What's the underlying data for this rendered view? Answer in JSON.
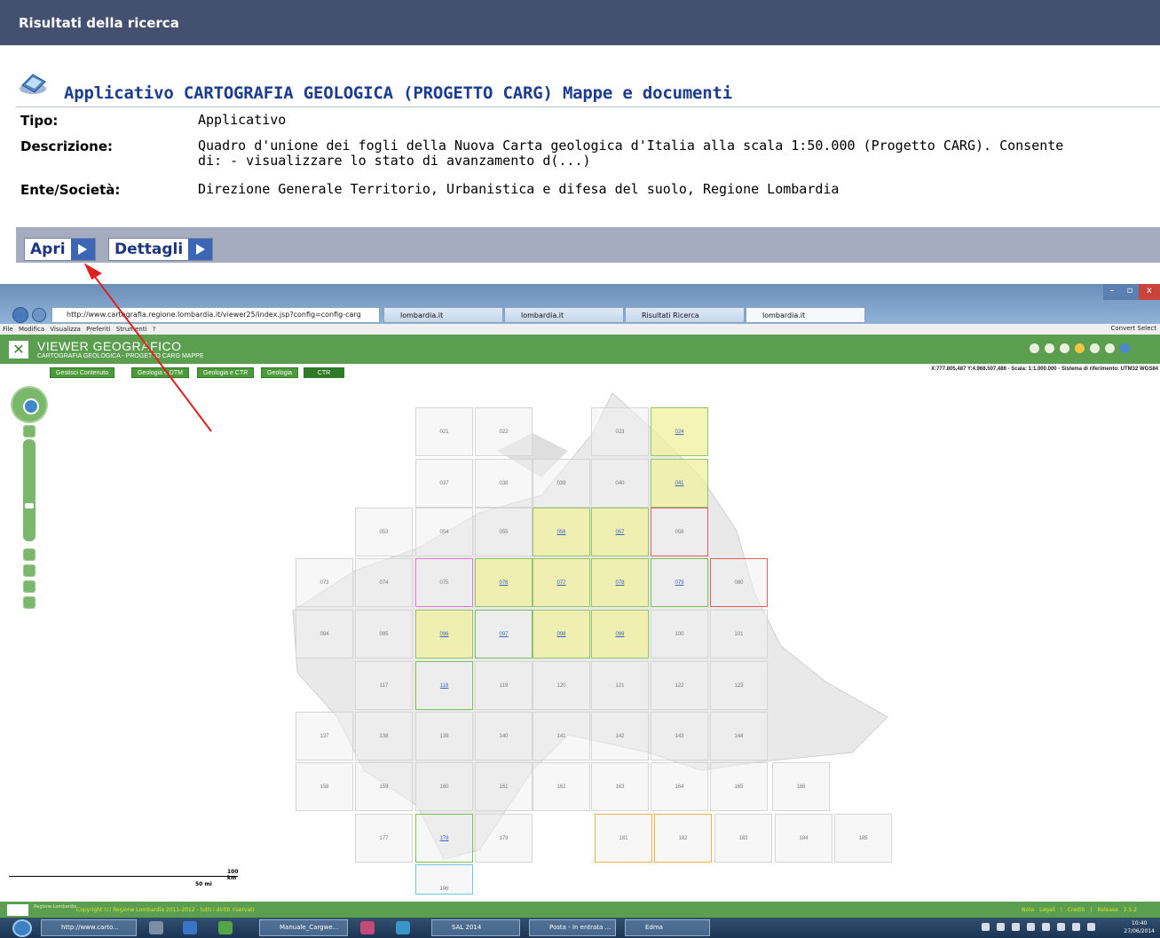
{
  "results": {
    "header": "Risultati della ricerca",
    "title": "Applicativo CARTOGRAFIA GEOLOGICA (PROGETTO CARG) Mappe e documenti",
    "tipo_label": "Tipo:",
    "tipo_value": "Applicativo",
    "descrizione_label": "Descrizione:",
    "descrizione_value": "Quadro d'unione dei fogli della Nuova Carta geologica d'Italia alla scala 1:50.000 (Progetto CARG). Consente\ndi: - visualizzare lo stato di avanzamento d(...)",
    "ente_label": "Ente/Società:",
    "ente_value": "Direzione Generale Territorio, Urbanistica e difesa del suolo, Regione Lombardia",
    "open_label": "Apri",
    "details_label": "Dettagli"
  },
  "browser": {
    "url": "http://www.cartografia.regione.lombardia.it/viewer25/index.jsp?config=config-carg",
    "tabs": [
      "lombardia.it",
      "lombardia.it",
      "Risultati Ricerca",
      "lombardia.it"
    ],
    "menu": "File  Modifica  Visualizza  Preferiti  Strumenti  ?",
    "menu_right": "Convert  Select"
  },
  "viewer": {
    "title": "VIEWER GEOGRAFICO",
    "subtitle": "CARTOGRAFIA GEOLOGICA - PROGETTO CARG MAPPE",
    "coords": "X:777.805,487 Y:4.968.507,486 - Scala: 1:1.000.000 - Sistema di riferimento: UTM32 WGS84",
    "tabs": [
      "Gestisci Contenuto",
      "Geologia e DTM",
      "Geologia e CTR",
      "Geologia",
      "CTR"
    ],
    "scale_km": "100 km",
    "scale_mi": "50 mi",
    "footer_region": "Regione Lombardia",
    "footer_copy": "Copyright (c) Regione Lombardia 2011-2012 - tutti i diritti riservati",
    "footer_links": "Note Legali  |  Crediti  |  Release 2.5.2"
  },
  "map_tiles": [
    {
      "label": "021",
      "state": "plain"
    },
    {
      "label": "022",
      "state": "plain"
    },
    {
      "label": "023",
      "state": "plain"
    },
    {
      "label": "024",
      "state": "yellow"
    },
    {
      "label": "037",
      "state": "plain"
    },
    {
      "label": "038",
      "state": "plain"
    },
    {
      "label": "039",
      "state": "plain"
    },
    {
      "label": "040",
      "state": "plain"
    },
    {
      "label": "041",
      "state": "yellow"
    },
    {
      "label": "053",
      "state": "plain"
    },
    {
      "label": "054",
      "state": "plain"
    },
    {
      "label": "055",
      "state": "plain"
    },
    {
      "label": "056",
      "state": "yellow"
    },
    {
      "label": "057",
      "state": "yellow"
    },
    {
      "label": "058",
      "state": "red"
    },
    {
      "label": "073",
      "state": "plain"
    },
    {
      "label": "074",
      "state": "plain"
    },
    {
      "label": "075",
      "state": "pink"
    },
    {
      "label": "076",
      "state": "yellow"
    },
    {
      "label": "077",
      "state": "yellow"
    },
    {
      "label": "078",
      "state": "yellow"
    },
    {
      "label": "079",
      "state": "green"
    },
    {
      "label": "080",
      "state": "red"
    },
    {
      "label": "094",
      "state": "plain"
    },
    {
      "label": "095",
      "state": "plain"
    },
    {
      "label": "096",
      "state": "yellow"
    },
    {
      "label": "097",
      "state": "green"
    },
    {
      "label": "098",
      "state": "yellow"
    },
    {
      "label": "099",
      "state": "yellow"
    },
    {
      "label": "100",
      "state": "plain"
    },
    {
      "label": "101",
      "state": "plain"
    },
    {
      "label": "117",
      "state": "plain"
    },
    {
      "label": "118",
      "state": "green"
    },
    {
      "label": "119",
      "state": "plain"
    },
    {
      "label": "120",
      "state": "plain"
    },
    {
      "label": "121",
      "state": "plain"
    },
    {
      "label": "122",
      "state": "plain"
    },
    {
      "label": "123",
      "state": "plain"
    },
    {
      "label": "137",
      "state": "plain"
    },
    {
      "label": "138",
      "state": "plain"
    },
    {
      "label": "139",
      "state": "plain"
    },
    {
      "label": "140",
      "state": "plain"
    },
    {
      "label": "141",
      "state": "plain"
    },
    {
      "label": "142",
      "state": "plain"
    },
    {
      "label": "143",
      "state": "plain"
    },
    {
      "label": "144",
      "state": "plain"
    },
    {
      "label": "158",
      "state": "plain"
    },
    {
      "label": "159",
      "state": "plain"
    },
    {
      "label": "160",
      "state": "plain"
    },
    {
      "label": "161",
      "state": "plain"
    },
    {
      "label": "162",
      "state": "plain"
    },
    {
      "label": "163",
      "state": "plain"
    },
    {
      "label": "164",
      "state": "plain"
    },
    {
      "label": "165",
      "state": "plain"
    },
    {
      "label": "166",
      "state": "plain"
    },
    {
      "label": "177",
      "state": "plain"
    },
    {
      "label": "178",
      "state": "green"
    },
    {
      "label": "179",
      "state": "plain"
    },
    {
      "label": "181",
      "state": "orange"
    },
    {
      "label": "182",
      "state": "orange"
    },
    {
      "label": "183",
      "state": "plain"
    },
    {
      "label": "184",
      "state": "plain"
    },
    {
      "label": "185",
      "state": "plain"
    },
    {
      "label": "196",
      "state": "cyan"
    }
  ],
  "taskbar": {
    "items": [
      "http://www.carto...",
      "Manuale_Cargwe...",
      "SAL 2014",
      "Posta - In entrata ...",
      "Edma"
    ],
    "time": "10:40",
    "date": "27/06/2014"
  },
  "colors": {
    "header_bg": "#43506f",
    "title_blue": "#1c3c91",
    "viewer_green": "#5b9e4f",
    "highlight_yellow": "#eff09e",
    "arrow_red": "#e02020"
  }
}
